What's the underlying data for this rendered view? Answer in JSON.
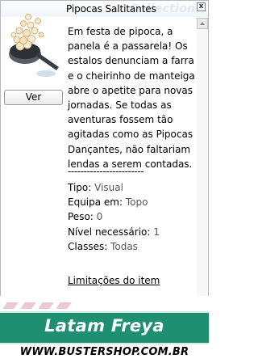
{
  "window": {
    "title": "Pipocas Saltitantes",
    "watermark": "Collections",
    "close_glyph": "x"
  },
  "item": {
    "image_icon": "popcorn-pan-icon",
    "view_button_label": "Ver",
    "description": "Em festa de pipoca, a panela é a passarela! Os estalos denunciam a farra e o cheirinho de manteiga abre o apetite para novas jornadas. Se todas as aventuras fossem tão agitadas como as Pipocas Dançantes, não faltariam lendas a serem contadas.",
    "separator": "------------------------",
    "properties": [
      {
        "label": "Tipo:",
        "value": "Visual"
      },
      {
        "label": "Equipa em:",
        "value": "Topo"
      },
      {
        "label": "Peso:",
        "value": "0"
      },
      {
        "label": "Nível necessário:",
        "value": "1"
      },
      {
        "label": "Classes:",
        "value": "Todas"
      }
    ],
    "limits_link": "Limitações do item"
  },
  "banner": {
    "title": "Latam Freya",
    "site": "WWW.BUSTERSHOP.COM.BR"
  },
  "colors": {
    "banner_green": "#1e8f70",
    "stripe_pink": "#ecc8d0"
  }
}
